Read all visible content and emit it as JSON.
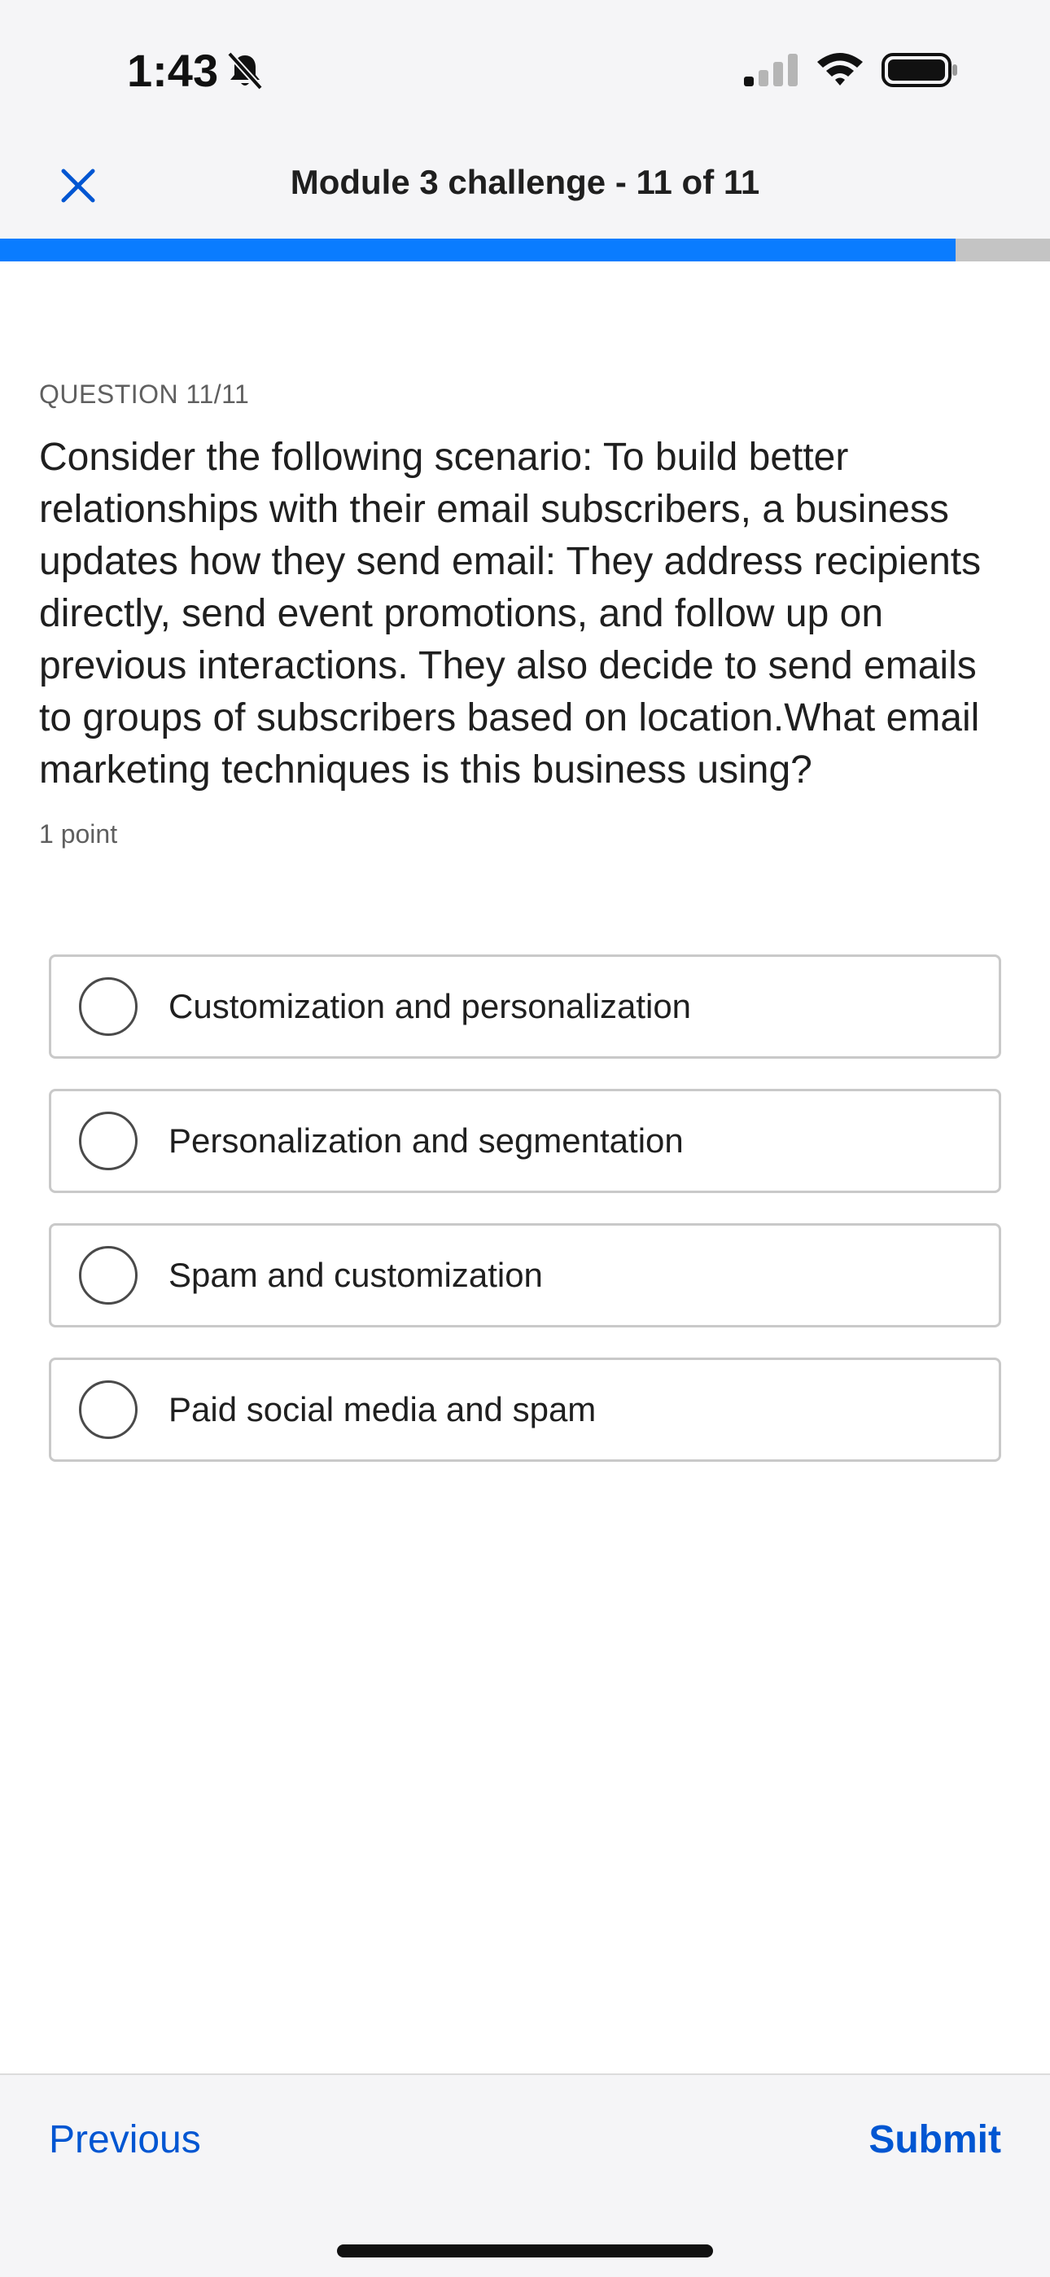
{
  "status_bar": {
    "time": "1:43"
  },
  "header": {
    "title": "Module 3 challenge - 11 of 11",
    "progress_fraction": 0.91
  },
  "question": {
    "label": "QUESTION 11/11",
    "text": "Consider the following scenario: To build better relationships with their email subscribers, a business updates how they send email: They address recipients directly, send event promotions, and follow up on previous interactions. They also decide to send emails to groups of subscribers based on location.What email marketing techniques is this business using?",
    "points": "1 point"
  },
  "options": [
    {
      "label": "Customization and personalization"
    },
    {
      "label": "Personalization and segmentation"
    },
    {
      "label": "Spam and customization"
    },
    {
      "label": "Paid social media and spam"
    }
  ],
  "footer": {
    "previous_label": "Previous",
    "submit_label": "Submit"
  },
  "colors": {
    "accent": "#0a7cff",
    "link": "#0056d2"
  }
}
